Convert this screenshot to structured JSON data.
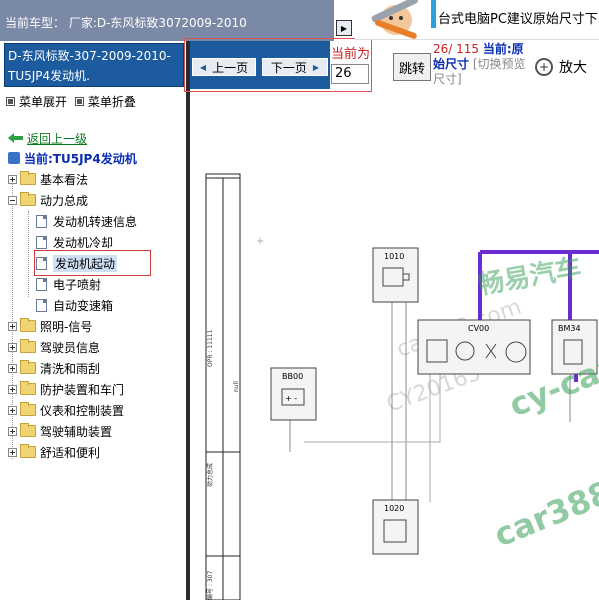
{
  "header": {
    "vehicle_title": "当前车型：  厂家:D-东风标致3072009-2010",
    "vehicle_box": "D-东风标致-307-2009-2010- TU5JP4发动机."
  },
  "menu": {
    "expand_label": "菜单展开",
    "collapse_label": "菜单折叠"
  },
  "tree": {
    "back_label": "返回上一级",
    "current_label": "当前:TU5JP4发动机",
    "folders": [
      "基本看法",
      "动力总成",
      "照明-信号",
      "驾驶员信息",
      "清洗和雨刮",
      "防护装置和车门",
      "仪表和控制装置",
      "驾驶辅助装置",
      "舒适和便利"
    ],
    "powertrain_children": [
      "发动机转速信息",
      "发动机冷却",
      "发动机起动",
      "电子喷射",
      "自动变速箱"
    ]
  },
  "toolbar": {
    "prev_label": "上一页",
    "next_label": "下一页",
    "current_page_label": "当前为",
    "page_value": "26",
    "jump_label": "跳转",
    "page_counter": "26/ 115",
    "mode_label": "当前:原始尺寸",
    "switch_hint": "[切换预览尺寸]",
    "zoom_label": "放大"
  },
  "banner": {
    "text": "台式电脑PC建议原始尺寸下"
  },
  "diagram": {
    "components": [
      {
        "code": "1010"
      },
      {
        "code": "CV00"
      },
      {
        "code": "BM34"
      },
      {
        "code": "BB00"
      },
      {
        "code": "1020"
      }
    ],
    "side_labels": [
      "OPR : 11111",
      "null",
      "动力总成",
      "编号 : 307"
    ],
    "watermarks": [
      "畅易汽车",
      "car388.com",
      "CY20165",
      "cy-car",
      "car388"
    ]
  },
  "colors": {
    "vehicle_box_bg": "#1c5b9e",
    "accent_red": "#cc2222",
    "link_green": "#0a7a20",
    "current_blue": "#0a2db4",
    "wire_purple": "#6a2bd0",
    "watermark_green": "#3aa05a"
  }
}
